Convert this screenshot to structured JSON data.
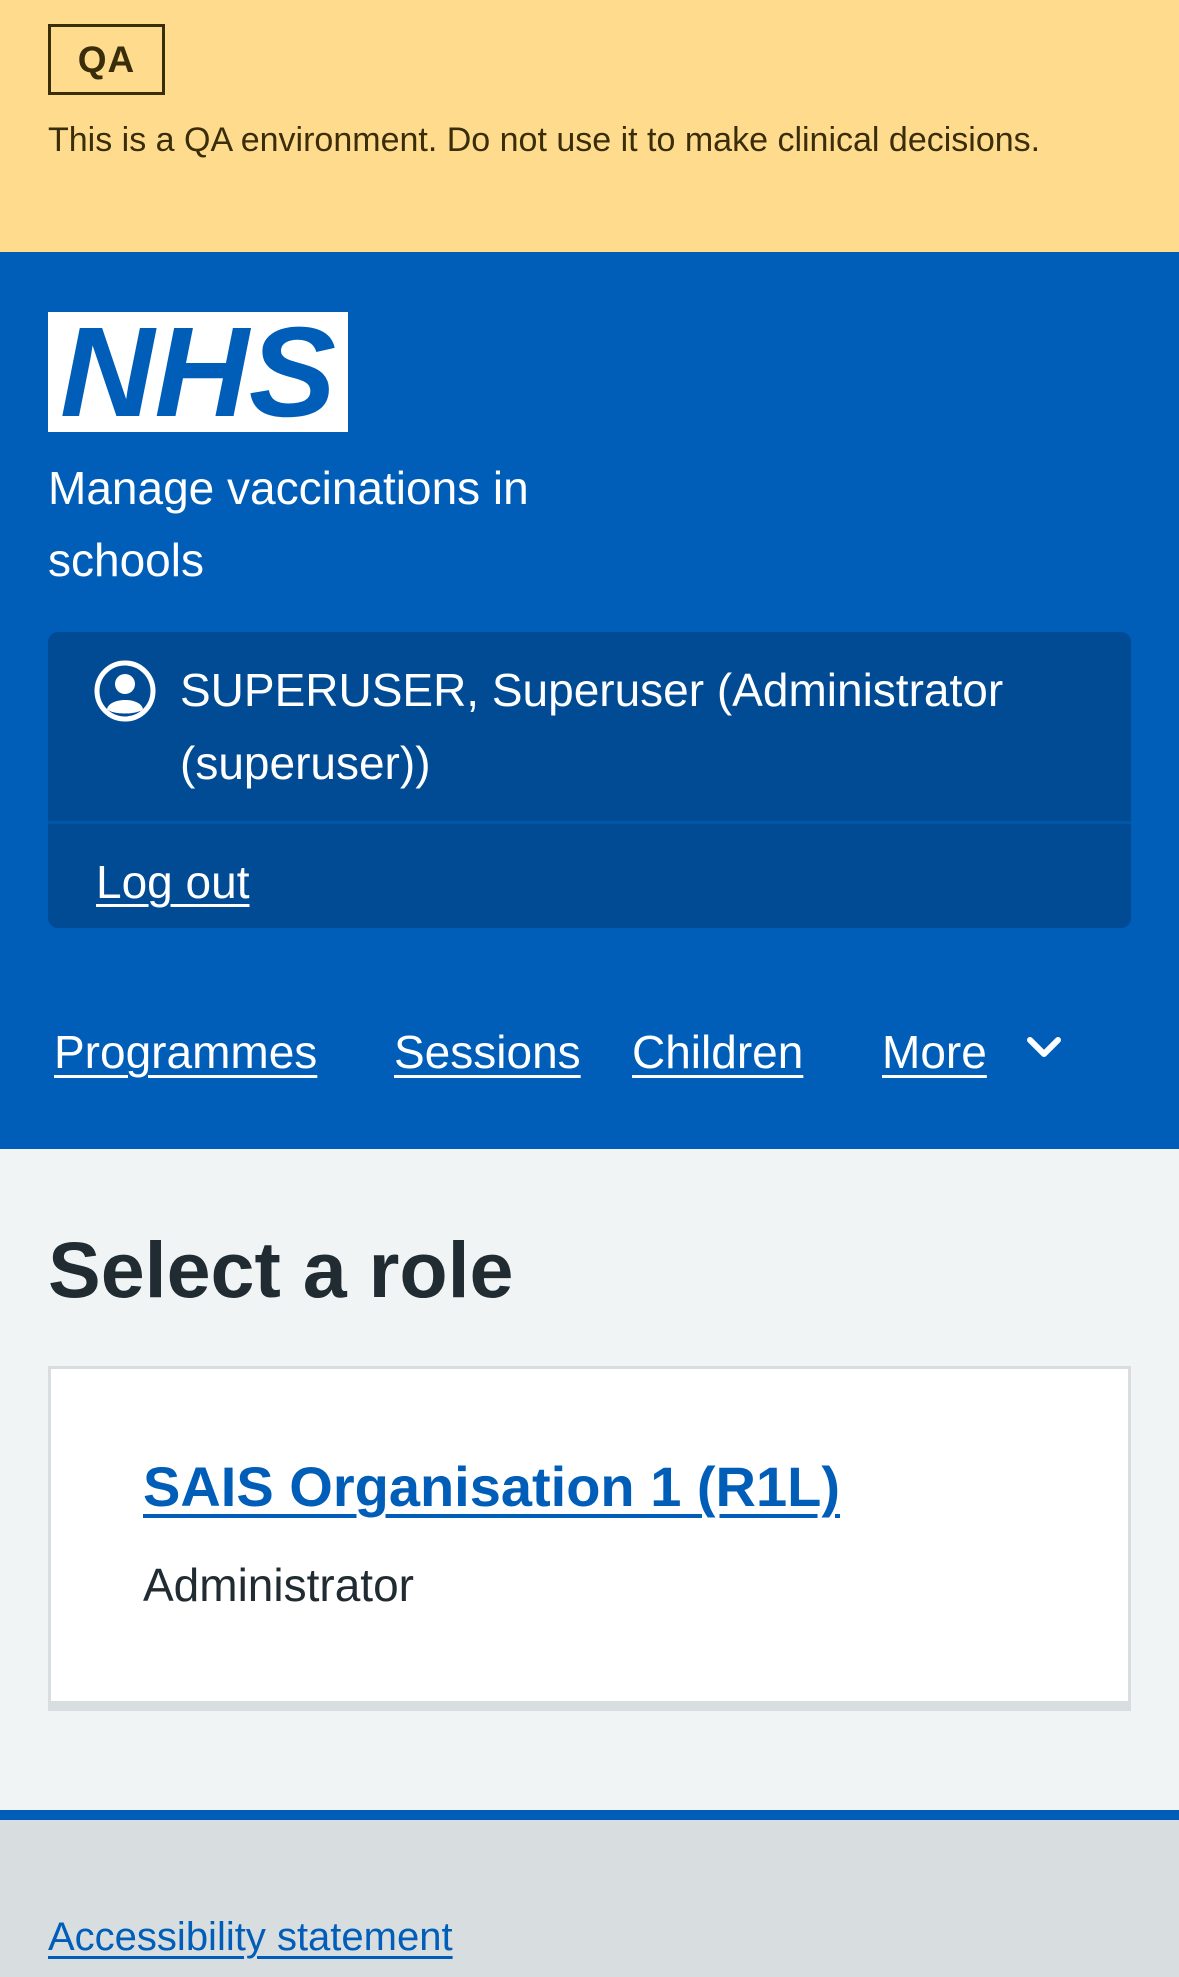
{
  "qa_banner": {
    "tag": "QA",
    "message": "This is a QA environment. Do not use it to make clinical decisions."
  },
  "header": {
    "logo_text": "NHS",
    "service_name": "Manage vaccinations in schools",
    "account": {
      "user_label": "SUPERUSER, Superuser (Administrator (superuser))",
      "logout_label": "Log out"
    },
    "nav": [
      {
        "label": "Programmes"
      },
      {
        "label": "Sessions"
      },
      {
        "label": "Children"
      },
      {
        "label": "More"
      }
    ]
  },
  "main": {
    "title": "Select a role",
    "roles": [
      {
        "organisation": "SAIS Organisation 1 (R1L)",
        "role": "Administrator"
      }
    ]
  },
  "footer": {
    "links": [
      {
        "label": "Accessibility statement"
      }
    ]
  },
  "colors": {
    "nhs_blue": "#005eb8",
    "qa_banner": "#ffdb8e",
    "account_panel": "#004b93",
    "page_background": "#f0f4f5",
    "footer_background": "#d8dde0"
  }
}
